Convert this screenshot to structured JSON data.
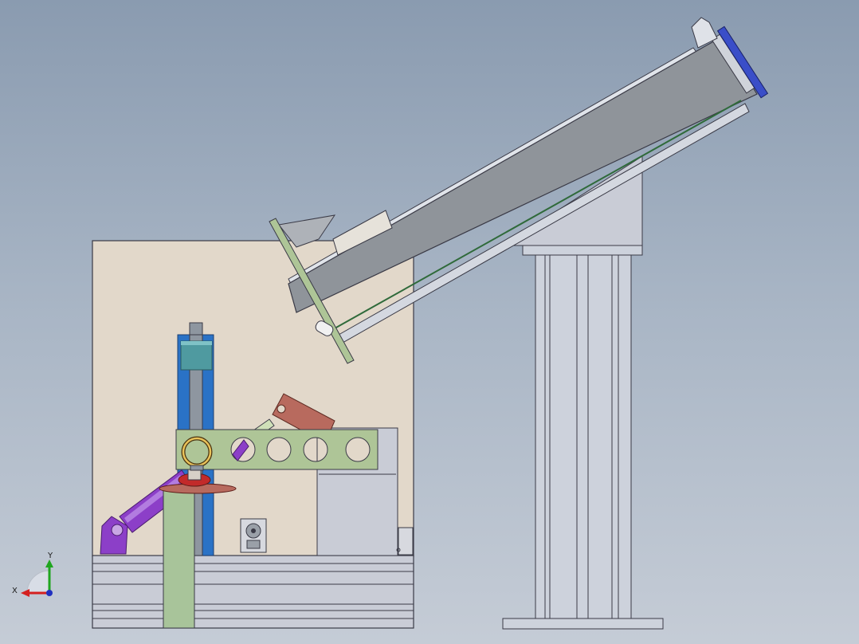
{
  "view": {
    "background_top": "#8a9bb0",
    "background_bottom": "#c5ccd6"
  },
  "triad": {
    "x_label": "X",
    "y_label": "Y",
    "x_color": "#d42020",
    "y_color": "#1fa61f",
    "z_color": "#2030c0"
  },
  "colors": {
    "panel": "#e2d8ca",
    "frame": "#c9ccd6",
    "edge": "#3a3a46",
    "rod_blue": "#2a72c6",
    "rod_gray": "#8e96a0",
    "cyan_block": "#4f9aa0",
    "green_plate": "#aec597",
    "green_post": "#a8c49a",
    "purple_cyl": "#8c3fc8",
    "brown_arm": "#b86a5e",
    "red_disc": "#c22a2a",
    "conveyor_gray": "#8f949a",
    "conveyor_cap": "#3a4ec8",
    "column": "#cdd2dc"
  }
}
